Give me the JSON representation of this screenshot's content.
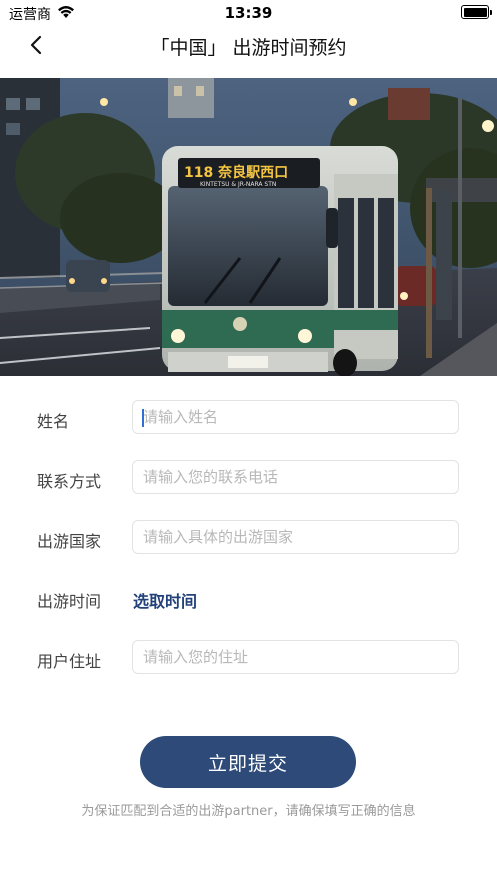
{
  "status_bar": {
    "carrier": "运营商",
    "time": "13:39"
  },
  "nav": {
    "title": "「中国」 出游时间预约"
  },
  "hero": {
    "bus_sign": "118 奈良駅西口",
    "bus_sign_sub": "KINTETSU & JR-NARA STN"
  },
  "form": {
    "name": {
      "label": "姓名",
      "placeholder": "请输入姓名"
    },
    "contact": {
      "label": "联系方式",
      "placeholder": "请输入您的联系电话"
    },
    "country": {
      "label": "出游国家",
      "placeholder": "请输入具体的出游国家"
    },
    "time": {
      "label": "出游时间",
      "action": "选取时间"
    },
    "address": {
      "label": "用户住址",
      "placeholder": "请输入您的住址"
    }
  },
  "submit_label": "立即提交",
  "tip": "为保证匹配到合适的出游partner，请确保填写正确的信息"
}
